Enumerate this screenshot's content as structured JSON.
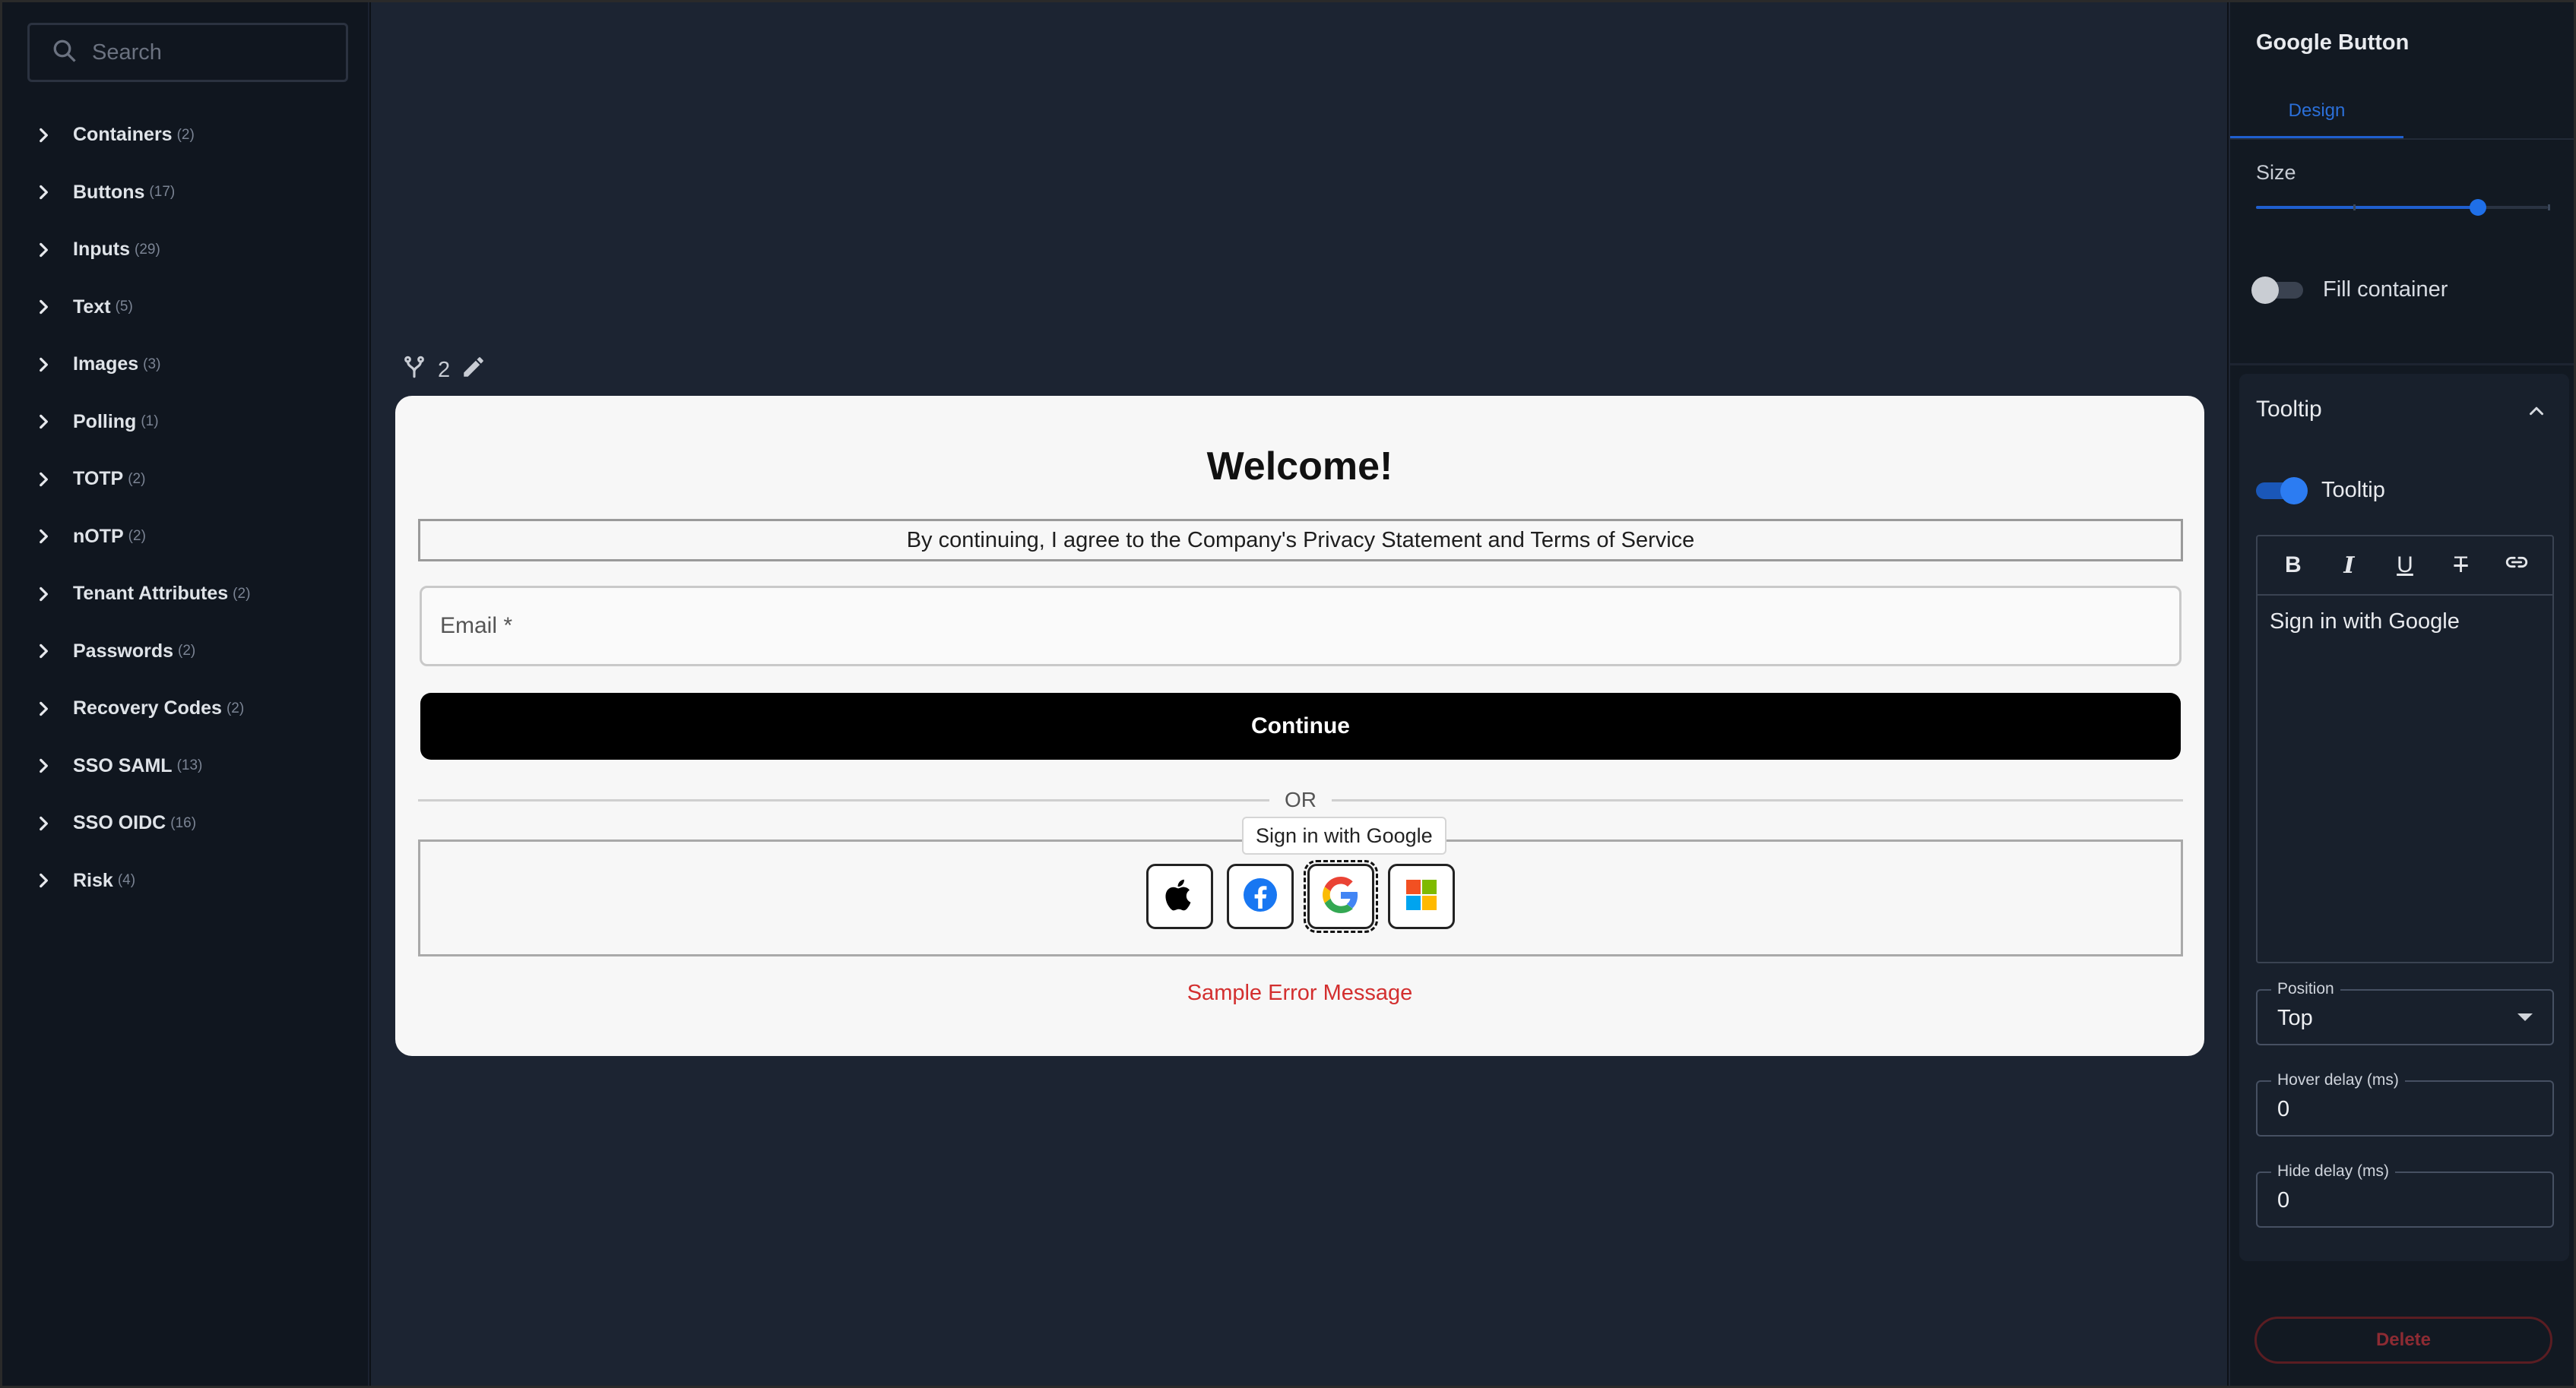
{
  "sidebar": {
    "search_placeholder": "Search",
    "items": [
      {
        "label": "Containers",
        "count": "(2)"
      },
      {
        "label": "Buttons",
        "count": "(17)"
      },
      {
        "label": "Inputs",
        "count": "(29)"
      },
      {
        "label": "Text",
        "count": "(5)"
      },
      {
        "label": "Images",
        "count": "(3)"
      },
      {
        "label": "Polling",
        "count": "(1)"
      },
      {
        "label": "TOTP",
        "count": "(2)"
      },
      {
        "label": "nOTP",
        "count": "(2)"
      },
      {
        "label": "Tenant Attributes",
        "count": "(2)"
      },
      {
        "label": "Passwords",
        "count": "(2)"
      },
      {
        "label": "Recovery Codes",
        "count": "(2)"
      },
      {
        "label": "SSO SAML",
        "count": "(13)"
      },
      {
        "label": "SSO OIDC",
        "count": "(16)"
      },
      {
        "label": "Risk",
        "count": "(4)"
      }
    ]
  },
  "canvas": {
    "flow_count": "2",
    "card": {
      "title": "Welcome!",
      "terms": "By continuing, I agree to the Company's Privacy Statement and Terms of Service",
      "email_label": "Email *",
      "continue_label": "Continue",
      "or_label": "OR",
      "tooltip": "Sign in with Google",
      "social_buttons": [
        {
          "icon": "apple-icon"
        },
        {
          "icon": "facebook-icon"
        },
        {
          "icon": "google-icon",
          "selected": true
        },
        {
          "icon": "microsoft-icon"
        }
      ],
      "error": "Sample Error Message"
    }
  },
  "panel": {
    "title": "Google Button",
    "tab_design": "Design",
    "size_label": "Size",
    "size_level": 0.76,
    "fill_container_label": "Fill container",
    "fill_container_on": false,
    "tooltip_section": {
      "heading": "Tooltip",
      "toggle_label": "Tooltip",
      "toggle_on": true,
      "content": "Sign in with Google",
      "position_label": "Position",
      "position_value": "Top",
      "hover_label": "Hover delay (ms)",
      "hover_value": "0",
      "hide_label": "Hide delay (ms)",
      "hide_value": "0"
    },
    "delete_label": "Delete"
  },
  "colors": {
    "accent": "#1f5fcf",
    "error": "#d32f2f",
    "sidebar_bg": "#10161f",
    "canvas_bg": "#1c2432",
    "card_bg": "#f7f7f7"
  }
}
